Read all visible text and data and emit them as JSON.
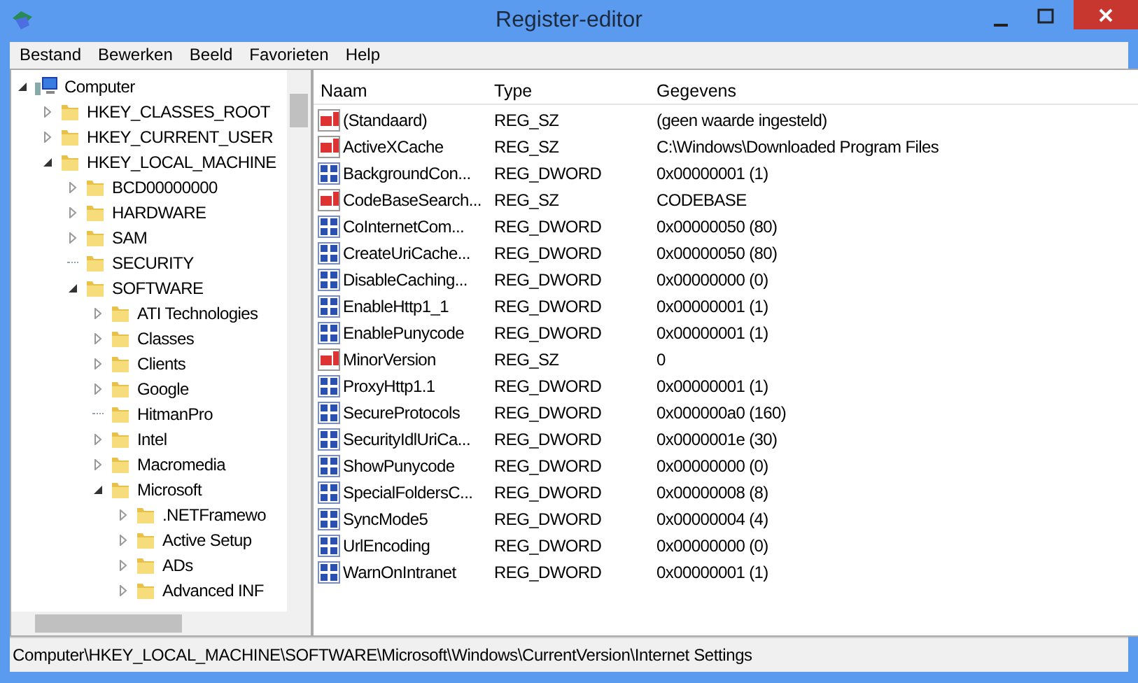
{
  "window": {
    "title": "Register-editor"
  },
  "menu": [
    "Bestand",
    "Bewerken",
    "Beeld",
    "Favorieten",
    "Help"
  ],
  "tree": [
    {
      "label": "Computer",
      "kind": "computer",
      "expanded": true,
      "children": [
        {
          "label": "HKEY_CLASSES_ROOT",
          "kind": "folder",
          "expanded": false
        },
        {
          "label": "HKEY_CURRENT_USER",
          "kind": "folder",
          "expanded": false
        },
        {
          "label": "HKEY_LOCAL_MACHINE",
          "kind": "folder",
          "expanded": true,
          "children": [
            {
              "label": "BCD00000000",
              "kind": "folder",
              "expanded": false
            },
            {
              "label": "HARDWARE",
              "kind": "folder",
              "expanded": false
            },
            {
              "label": "SAM",
              "kind": "folder",
              "expanded": false
            },
            {
              "label": "SECURITY",
              "kind": "leaf"
            },
            {
              "label": "SOFTWARE",
              "kind": "folder",
              "expanded": true,
              "children": [
                {
                  "label": "ATI Technologies",
                  "kind": "folder",
                  "expanded": false
                },
                {
                  "label": "Classes",
                  "kind": "folder",
                  "expanded": false
                },
                {
                  "label": "Clients",
                  "kind": "folder",
                  "expanded": false
                },
                {
                  "label": "Google",
                  "kind": "folder",
                  "expanded": false
                },
                {
                  "label": "HitmanPro",
                  "kind": "leaf"
                },
                {
                  "label": "Intel",
                  "kind": "folder",
                  "expanded": false
                },
                {
                  "label": "Macromedia",
                  "kind": "folder",
                  "expanded": false
                },
                {
                  "label": "Microsoft",
                  "kind": "folder",
                  "expanded": true,
                  "children": [
                    {
                      "label": ".NETFramewo",
                      "kind": "folder",
                      "expanded": false
                    },
                    {
                      "label": "Active Setup",
                      "kind": "folder",
                      "expanded": false
                    },
                    {
                      "label": "ADs",
                      "kind": "folder",
                      "expanded": false
                    },
                    {
                      "label": "Advanced INF",
                      "kind": "folder",
                      "expanded": false
                    }
                  ]
                }
              ]
            }
          ]
        }
      ]
    }
  ],
  "table": {
    "columns": [
      "Naam",
      "Type",
      "Gegevens"
    ],
    "rows": [
      {
        "kind": "string",
        "name": "(Standaard)",
        "type": "REG_SZ",
        "data": "(geen waarde ingesteld)"
      },
      {
        "kind": "string",
        "name": "ActiveXCache",
        "type": "REG_SZ",
        "data": "C:\\Windows\\Downloaded Program Files"
      },
      {
        "kind": "binary",
        "name": "BackgroundCon...",
        "type": "REG_DWORD",
        "data": "0x00000001 (1)"
      },
      {
        "kind": "string",
        "name": "CodeBaseSearch...",
        "type": "REG_SZ",
        "data": "CODEBASE"
      },
      {
        "kind": "binary",
        "name": "CoInternetCom...",
        "type": "REG_DWORD",
        "data": "0x00000050 (80)"
      },
      {
        "kind": "binary",
        "name": "CreateUriCache...",
        "type": "REG_DWORD",
        "data": "0x00000050 (80)"
      },
      {
        "kind": "binary",
        "name": "DisableCaching...",
        "type": "REG_DWORD",
        "data": "0x00000000 (0)"
      },
      {
        "kind": "binary",
        "name": "EnableHttp1_1",
        "type": "REG_DWORD",
        "data": "0x00000001 (1)"
      },
      {
        "kind": "binary",
        "name": "EnablePunycode",
        "type": "REG_DWORD",
        "data": "0x00000001 (1)"
      },
      {
        "kind": "string",
        "name": "MinorVersion",
        "type": "REG_SZ",
        "data": "0"
      },
      {
        "kind": "binary",
        "name": "ProxyHttp1.1",
        "type": "REG_DWORD",
        "data": "0x00000001 (1)"
      },
      {
        "kind": "binary",
        "name": "SecureProtocols",
        "type": "REG_DWORD",
        "data": "0x000000a0 (160)"
      },
      {
        "kind": "binary",
        "name": "SecurityIdlUriCa...",
        "type": "REG_DWORD",
        "data": "0x0000001e (30)"
      },
      {
        "kind": "binary",
        "name": "ShowPunycode",
        "type": "REG_DWORD",
        "data": "0x00000000 (0)"
      },
      {
        "kind": "binary",
        "name": "SpecialFoldersC...",
        "type": "REG_DWORD",
        "data": "0x00000008 (8)"
      },
      {
        "kind": "binary",
        "name": "SyncMode5",
        "type": "REG_DWORD",
        "data": "0x00000004 (4)"
      },
      {
        "kind": "binary",
        "name": "UrlEncoding",
        "type": "REG_DWORD",
        "data": "0x00000000 (0)"
      },
      {
        "kind": "binary",
        "name": "WarnOnIntranet",
        "type": "REG_DWORD",
        "data": "0x00000001 (1)"
      }
    ]
  },
  "status_bar": "Computer\\HKEY_LOCAL_MACHINE\\SOFTWARE\\Microsoft\\Windows\\CurrentVersion\\Internet Settings"
}
